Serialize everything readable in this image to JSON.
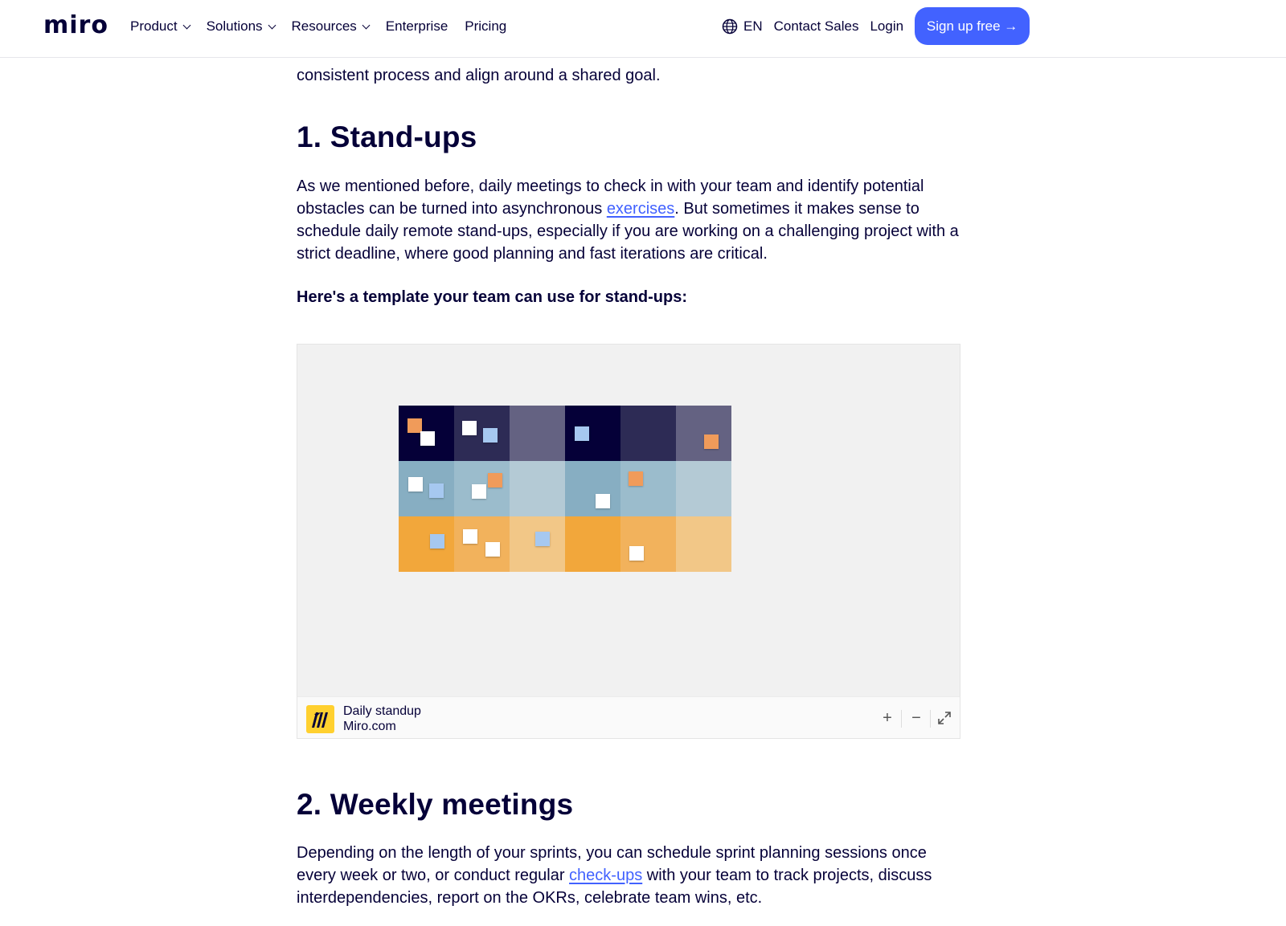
{
  "header": {
    "logo": "miro",
    "nav": [
      {
        "label": "Product",
        "has_dropdown": true
      },
      {
        "label": "Solutions",
        "has_dropdown": true
      },
      {
        "label": "Resources",
        "has_dropdown": true
      },
      {
        "label": "Enterprise",
        "has_dropdown": false
      },
      {
        "label": "Pricing",
        "has_dropdown": false
      }
    ],
    "language": "EN",
    "contact_sales": "Contact Sales",
    "login": "Login",
    "signup": "Sign up free →"
  },
  "article": {
    "intro_partial": "consistent process and align around a shared goal.",
    "section1": {
      "heading": "1. Stand-ups",
      "para_before_link": "As we mentioned before, daily meetings to check in with your team and identify potential obstacles can be turned into asynchronous ",
      "link": "exercises",
      "para_after_link": ". But sometimes it makes sense to schedule daily remote stand-ups, especially if you are working on a challenging project with a strict deadline, where good planning and fast iterations are critical.",
      "template_intro": "Here's a template your team can use for stand-ups:"
    },
    "embed": {
      "title": "Daily standup",
      "subtitle": "Miro.com",
      "zoom_in": "+",
      "zoom_out": "−",
      "fullscreen_icon": "expand-icon"
    },
    "section2": {
      "heading": "2. Weekly meetings",
      "para_before_link": "Depending on the length of your sprints, you can schedule sprint planning sessions once every week or two, or conduct regular ",
      "link": "check-ups",
      "para_after_link": " with your team to track projects, discuss interdependencies, report on the OKRs, celebrate team wins, etc."
    }
  },
  "colors": {
    "accent": "#4262ff",
    "text": "#050038",
    "badge": "#ffd02f"
  }
}
